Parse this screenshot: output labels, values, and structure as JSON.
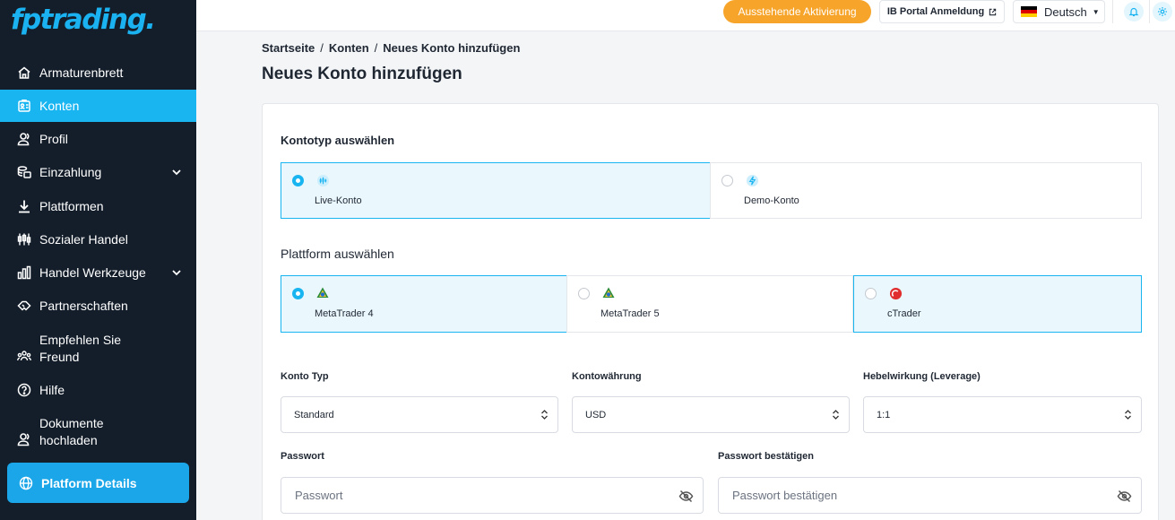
{
  "brand": {
    "logo_text": "fptrading",
    "logo_dot": "."
  },
  "sidebar": {
    "items": [
      {
        "label": "Armaturenbrett",
        "icon": "home-icon"
      },
      {
        "label": "Konten",
        "icon": "accounts-icon"
      },
      {
        "label": "Profil",
        "icon": "users-icon"
      },
      {
        "label": "Einzahlung",
        "icon": "money-icon"
      },
      {
        "label": "Plattformen",
        "icon": "download-icon"
      },
      {
        "label": "Sozialer Handel",
        "icon": "candlestick-icon"
      },
      {
        "label": "Handel Werkzeuge",
        "icon": "bar-chart-icon"
      },
      {
        "label": "Partnerschaften",
        "icon": "handshake-icon"
      },
      {
        "label_line1": "Empfehlen Sie",
        "label_line2": "Freund",
        "icon": "group-icon"
      },
      {
        "label": "Hilfe",
        "icon": "help-icon"
      },
      {
        "label_line1": "Dokumente",
        "label_line2": "hochladen",
        "icon": "users-icon"
      }
    ],
    "platform_details": "Platform Details"
  },
  "topbar": {
    "pending_label": "Ausstehende Aktivierung",
    "ib_label": "IB Portal Anmeldung",
    "language": "Deutsch"
  },
  "breadcrumb": {
    "home": "Startseite",
    "accounts": "Konten",
    "current": "Neues Konto hinzufügen"
  },
  "page_title": "Neues Konto hinzufügen",
  "form": {
    "account_type_title": "Kontotyp auswählen",
    "account_types": [
      {
        "label": "Live-Konto",
        "selected": true
      },
      {
        "label": "Demo-Konto",
        "selected": false
      }
    ],
    "platform_title": "Plattform auswählen",
    "platforms": [
      {
        "label": "MetaTrader 4",
        "selected": true
      },
      {
        "label": "MetaTrader 5",
        "selected": false
      },
      {
        "label": "cTrader",
        "selected": false
      }
    ],
    "konto_typ_label": "Konto Typ",
    "konto_typ_value": "Standard",
    "currency_label": "Kontowährung",
    "currency_value": "USD",
    "leverage_label": "Hebelwirkung (Leverage)",
    "leverage_value": "1:1",
    "password_label": "Passwort",
    "password_placeholder": "Passwort",
    "confirm_label": "Passwort bestätigen",
    "confirm_placeholder": "Passwort bestätigen"
  },
  "colors": {
    "sidebar_bg": "#141e2b",
    "accent": "#19b5f1",
    "pending": "#f7a42a",
    "selected_bg": "#eaf8fe"
  }
}
